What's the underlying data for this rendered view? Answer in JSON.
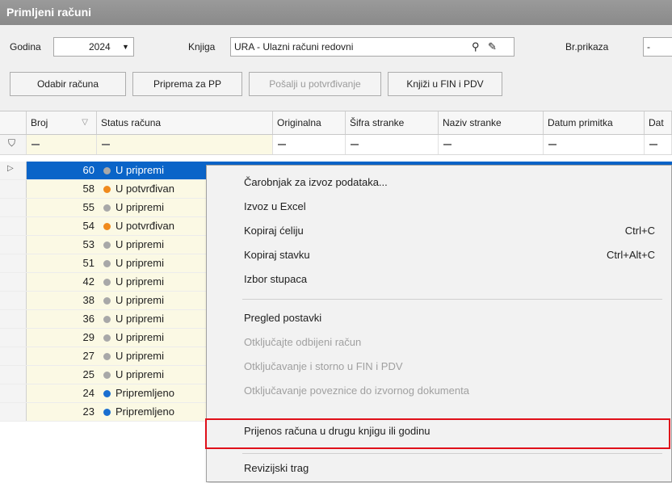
{
  "window": {
    "title": "Primljeni računi"
  },
  "filters": {
    "year_label": "Godina",
    "year_value": "2024",
    "book_label": "Knjiga",
    "book_value": "URA - Ulazni računi redovni",
    "count_label": "Br.prikaza",
    "count_value": "-"
  },
  "toolbar": {
    "select_invoice": "Odabir računa",
    "prepare_pp": "Priprema za PP",
    "send_confirm": "Pošalji u potvrđivanje",
    "post_fin": "Knjiži u FIN i PDV"
  },
  "grid": {
    "columns": [
      "Broj",
      "Status računa",
      "Originalna",
      "Šifra stranke",
      "Naziv stranke",
      "Datum primitka",
      "Dat"
    ],
    "rows": [
      {
        "broj": "60",
        "status": "U pripremi",
        "color": "#a8a8a8"
      },
      {
        "broj": "58",
        "status": "U potvrđivan",
        "color": "#f08a1c"
      },
      {
        "broj": "55",
        "status": "U pripremi",
        "color": "#a8a8a8"
      },
      {
        "broj": "54",
        "status": "U potvrđivan",
        "color": "#f08a1c"
      },
      {
        "broj": "53",
        "status": "U pripremi",
        "color": "#a8a8a8"
      },
      {
        "broj": "51",
        "status": "U pripremi",
        "color": "#a8a8a8"
      },
      {
        "broj": "42",
        "status": "U pripremi",
        "color": "#a8a8a8"
      },
      {
        "broj": "38",
        "status": "U pripremi",
        "color": "#a8a8a8"
      },
      {
        "broj": "36",
        "status": "U pripremi",
        "color": "#a8a8a8"
      },
      {
        "broj": "29",
        "status": "U pripremi",
        "color": "#a8a8a8"
      },
      {
        "broj": "27",
        "status": "U pripremi",
        "color": "#a8a8a8"
      },
      {
        "broj": "25",
        "status": "U pripremi",
        "color": "#a8a8a8"
      },
      {
        "broj": "24",
        "status": "Pripremljeno",
        "color": "#1a6fd0"
      },
      {
        "broj": "23",
        "status": "Pripremljeno",
        "color": "#1a6fd0"
      }
    ]
  },
  "context_menu": {
    "export_wizard": "Čarobnjak za izvoz podataka...",
    "export_excel": "Izvoz u Excel",
    "copy_cell": "Kopiraj ćeliju",
    "copy_cell_shortcut": "Ctrl+C",
    "copy_item": "Kopiraj stavku",
    "copy_item_shortcut": "Ctrl+Alt+C",
    "columns": "Izbor stupaca",
    "view_settings": "Pregled postavki",
    "unlock_rejected": "Otključajte odbijeni račun",
    "unlock_storno": "Otključavanje i storno u FIN i PDV",
    "unlock_link": "Otključavanje poveznice do izvornog dokumenta",
    "transfer": "Prijenos računa u drugu knjigu ili godinu",
    "audit": "Revizijski trag"
  },
  "colors": {
    "selection": "#0a64c8",
    "highlight": "#e0101a"
  }
}
